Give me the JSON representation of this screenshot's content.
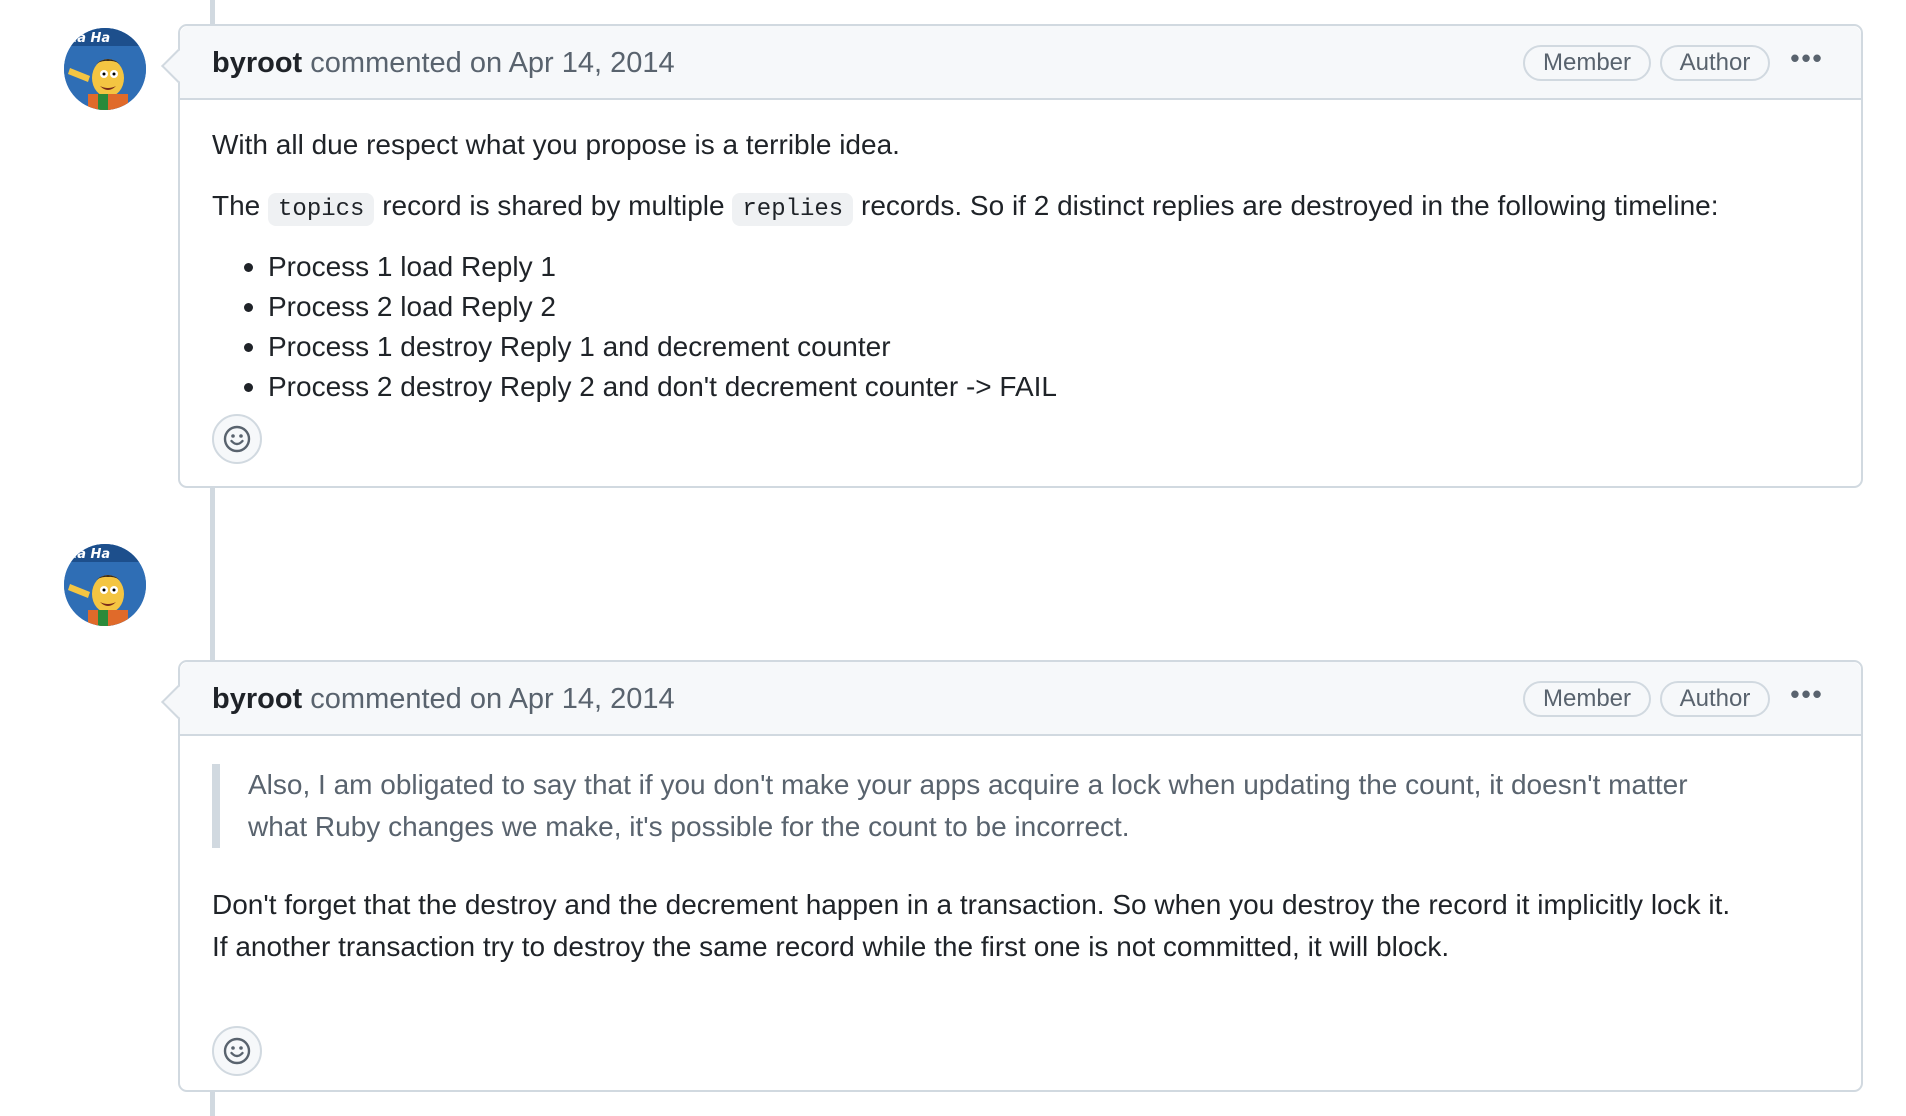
{
  "comments": [
    {
      "author": "byroot",
      "meta": "commented on Apr 14, 2014",
      "badges": {
        "member": "Member",
        "author": "Author"
      },
      "menu_label": "•••",
      "body": {
        "p1": "With all due respect what you propose is a terrible idea.",
        "p2_before": "The ",
        "p2_code1": "topics",
        "p2_middle": " record is shared by multiple ",
        "p2_code2": "replies",
        "p2_after": " records. So if 2 distinct replies are destroyed in the following timeline:",
        "items": [
          "Process 1 load Reply 1",
          "Process 2 load Reply 2",
          "Process 1 destroy Reply 1 and decrement counter",
          "Process 2 destroy Reply 2 and don't decrement counter -> FAIL"
        ]
      },
      "avatar_icon": "avatar-icon",
      "reaction_icon": "smiley-icon"
    },
    {
      "author": "byroot",
      "meta": "commented on Apr 14, 2014",
      "badges": {
        "member": "Member",
        "author": "Author"
      },
      "menu_label": "•••",
      "body": {
        "quote_line1": "Also, I am obligated to say that if you don't make your apps acquire a lock when updating the count, it doesn't matter",
        "quote_line2": "what Ruby changes we make, it's possible for the count to be incorrect.",
        "p_line1": "Don't forget that the destroy and the decrement happen in a transaction. So when you destroy the record it implicitly lock it.",
        "p_line2": "If another transaction try to destroy the same record while the first one is not committed, it will block."
      },
      "avatar_icon": "avatar-icon",
      "reaction_icon": "smiley-icon"
    }
  ],
  "colors": {
    "border": "#d1d9e0",
    "header_bg": "#f6f8fa",
    "text": "#1f2328",
    "muted": "#59636e"
  }
}
